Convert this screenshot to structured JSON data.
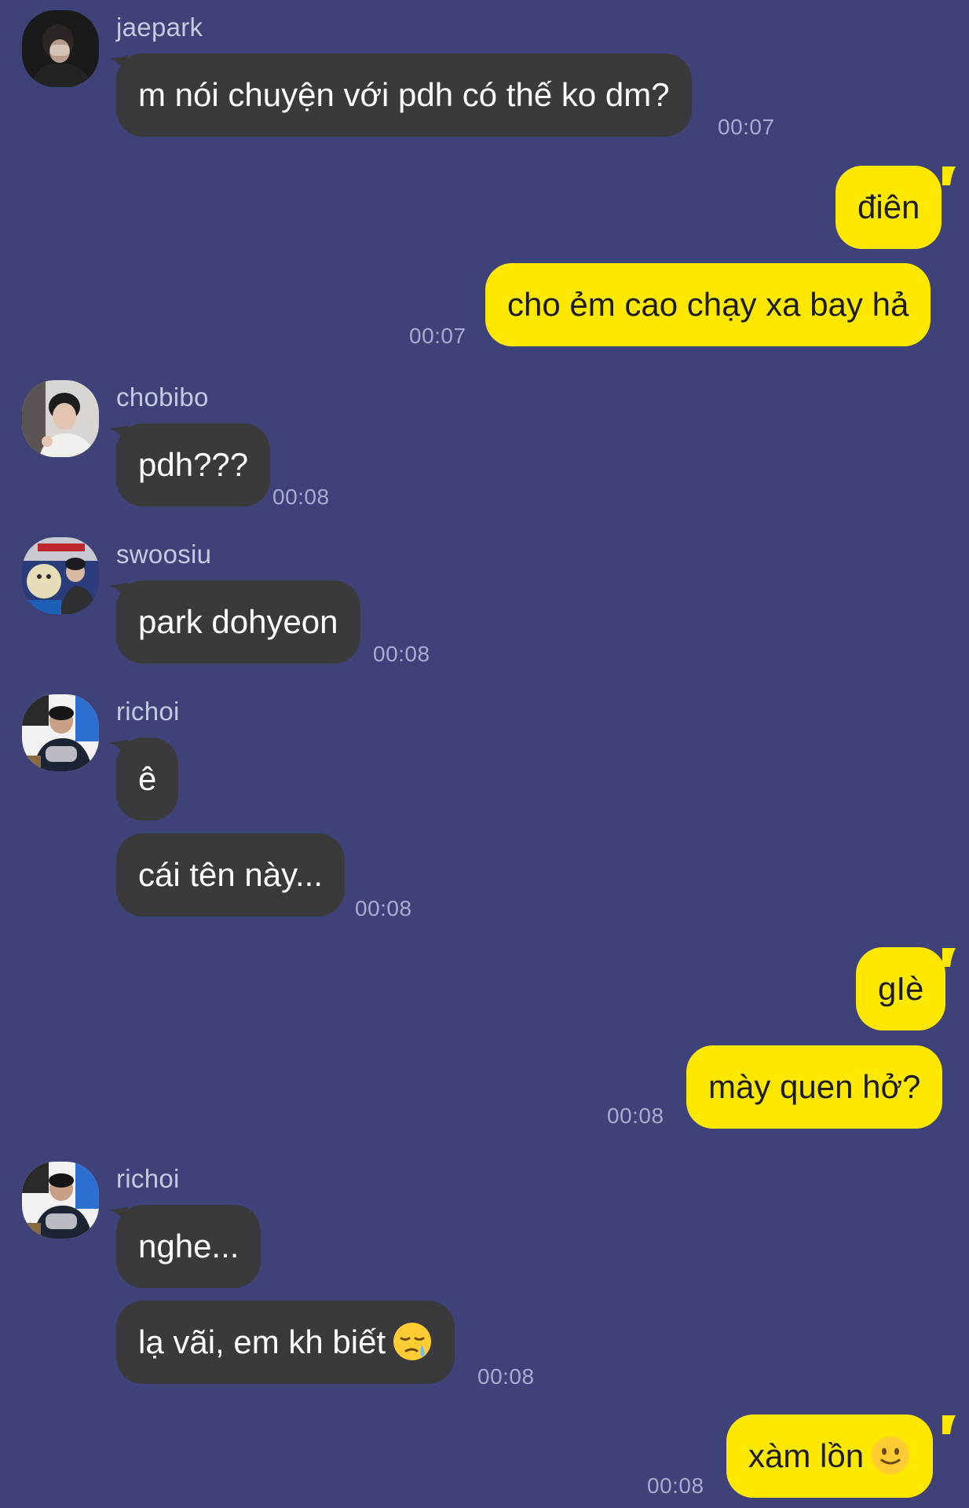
{
  "messages": [
    {
      "sender": "jaepark",
      "text": "m nói chuyện với pdh có thế ko dm?",
      "time": "00:07"
    },
    {
      "text": "điên"
    },
    {
      "text": "cho ẻm cao chạy xa bay hả",
      "time": "00:07"
    },
    {
      "sender": "chobibo",
      "text": "pdh???",
      "time": "00:08"
    },
    {
      "sender": "swoosiu",
      "text": "park dohyeon",
      "time": "00:08"
    },
    {
      "sender": "richoi",
      "text": "ê"
    },
    {
      "text": "cái tên này...",
      "time": "00:08"
    },
    {
      "text": "gIè"
    },
    {
      "text": "mày quen hở?",
      "time": "00:08"
    },
    {
      "sender": "richoi",
      "text": "nghe..."
    },
    {
      "text": "lạ vãi, em kh biết",
      "emoji": "sleepy-face-emoji",
      "time": "00:08"
    },
    {
      "text": "xàm lồn",
      "emoji": "slightly-smiling-face-emoji",
      "time": "00:08"
    }
  ],
  "colors": {
    "background": "#3f4278",
    "incoming_bubble": "#3a3a3c",
    "outgoing_bubble": "#ffe800",
    "timestamp": "#a9abd0",
    "sender_name": "#c7c9e2"
  }
}
